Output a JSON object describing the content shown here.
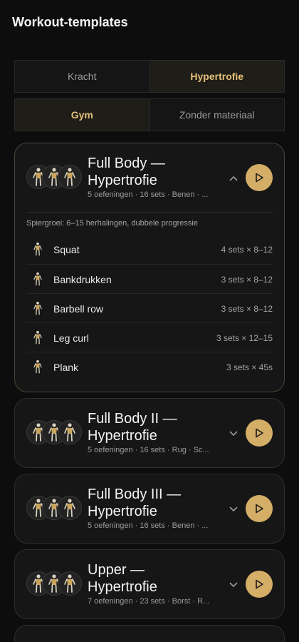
{
  "header": {
    "title": "Workout-templates"
  },
  "goal_tabs": [
    {
      "label": "Kracht",
      "active": false
    },
    {
      "label": "Hypertrofie",
      "active": true
    }
  ],
  "equipment_tabs": [
    {
      "label": "Gym",
      "active": true
    },
    {
      "label": "Zonder materiaal",
      "active": false
    }
  ],
  "colors": {
    "accent": "#d4ae67",
    "accent_text": "#e5c07a",
    "background": "#0d0d0d",
    "card": "#161616"
  },
  "templates": [
    {
      "title_line1": "Full Body —",
      "title_line2": "Hypertrofie",
      "meta": "5 oefeningen · 16 sets · Benen · ...",
      "expanded": true,
      "goal": "Spiergroei: 6–15 herhalingen, dubbele progressie",
      "exercises": [
        {
          "name": "Squat",
          "sets": "4 sets × 8–12"
        },
        {
          "name": "Bankdrukken",
          "sets": "3 sets × 8–12"
        },
        {
          "name": "Barbell row",
          "sets": "3 sets × 8–12"
        },
        {
          "name": "Leg curl",
          "sets": "3 sets × 12–15"
        },
        {
          "name": "Plank",
          "sets": "3 sets × 45s"
        }
      ]
    },
    {
      "title_line1": "Full Body II —",
      "title_line2": "Hypertrofie",
      "meta": "5 oefeningen · 16 sets · Rug · Sc...",
      "expanded": false
    },
    {
      "title_line1": "Full Body III —",
      "title_line2": "Hypertrofie",
      "meta": "5 oefeningen · 16 sets · Benen · ...",
      "expanded": false
    },
    {
      "title_line1": "Upper —",
      "title_line2": "Hypertrofie",
      "meta": "7 oefeningen · 23 sets · Borst · R...",
      "expanded": false
    }
  ],
  "icons": {
    "collapse": "chevron-up-icon",
    "expand": "chevron-down-icon",
    "start": "play-icon",
    "muscle": "body-figure-icon"
  }
}
